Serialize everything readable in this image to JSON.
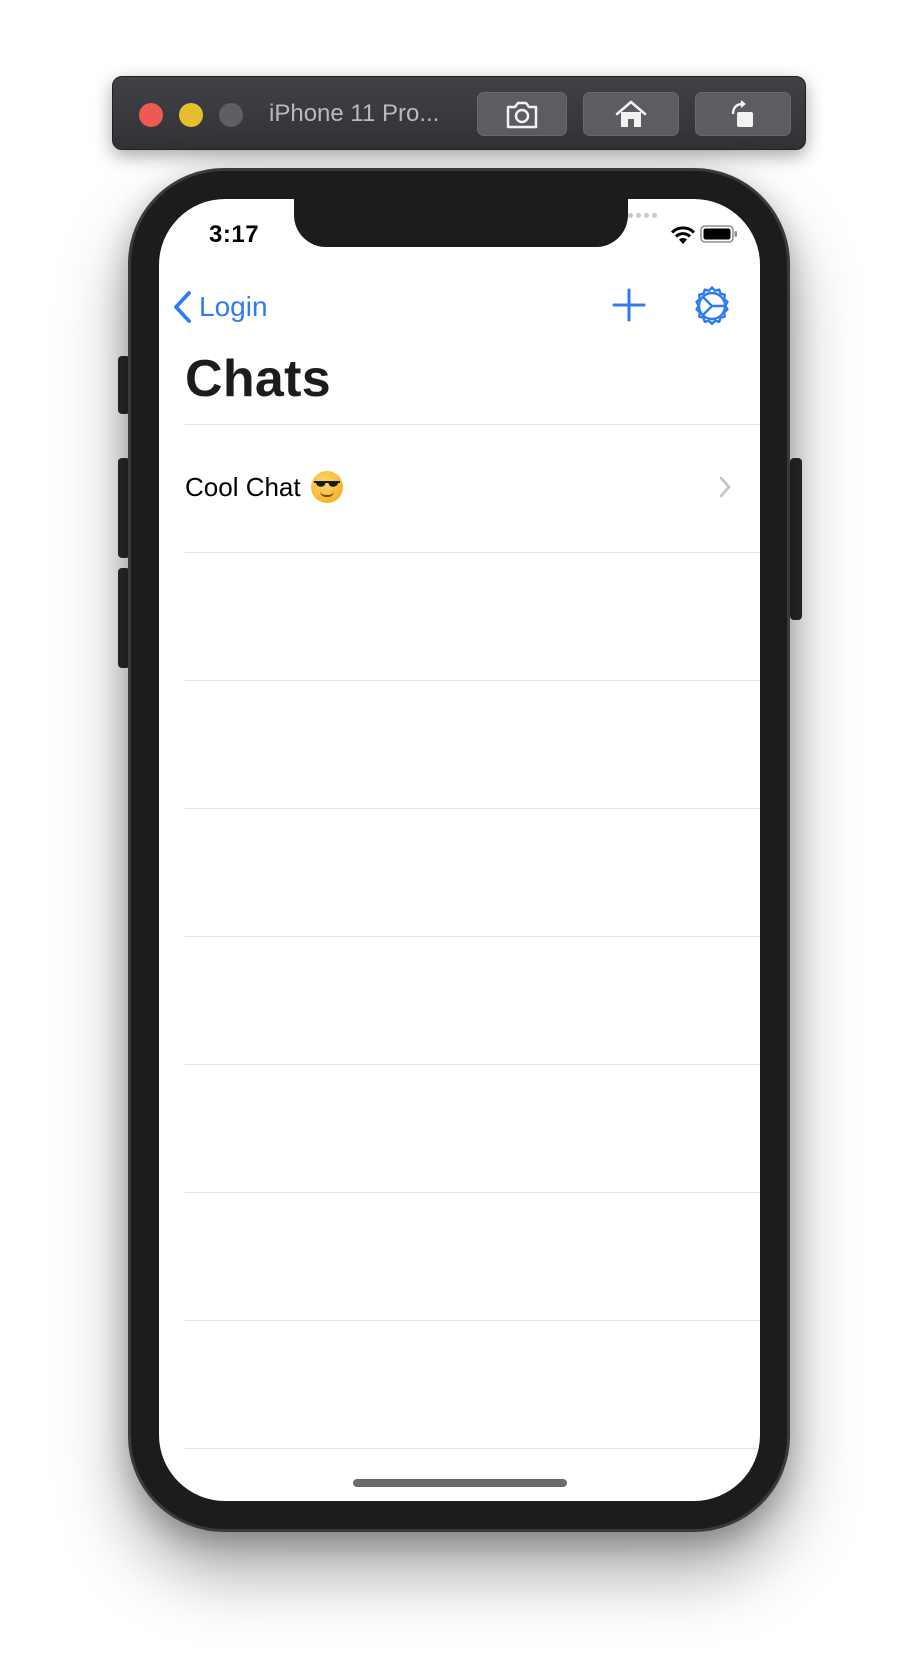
{
  "simulator": {
    "title": "iPhone 11 Pro...",
    "buttons": [
      "screenshot-icon",
      "home-icon",
      "rotate-icon"
    ]
  },
  "status_bar": {
    "time": "3:17"
  },
  "nav": {
    "back_label": "Login",
    "add_icon": "plus-icon",
    "settings_icon": "gear-icon",
    "accent_color": "#2f7bf5"
  },
  "page": {
    "title": "Chats"
  },
  "chats": [
    {
      "name": "Cool Chat",
      "emoji": "smiling-face-with-sunglasses"
    }
  ]
}
